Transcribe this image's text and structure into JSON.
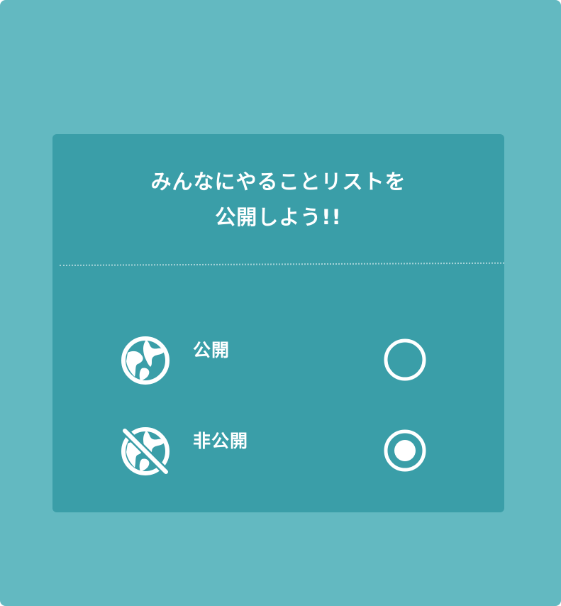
{
  "dialog": {
    "title_line1": "みんなにやることリストを",
    "title_line2": "公開しよう!!"
  },
  "options": [
    {
      "label": "公開",
      "icon": "globe-icon",
      "selected": false
    },
    {
      "label": "非公開",
      "icon": "globe-off-icon",
      "selected": true
    }
  ],
  "colors": {
    "background": "#63b9c1",
    "card": "#3a9ea8",
    "foreground": "#ffffff"
  }
}
